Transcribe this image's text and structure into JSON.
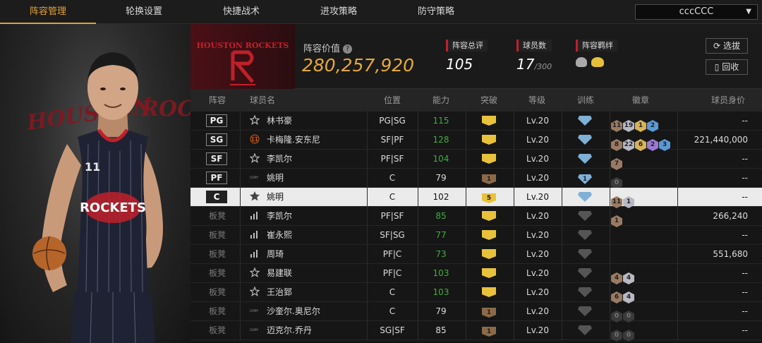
{
  "nav": {
    "tabs": [
      "阵容管理",
      "轮换设置",
      "快捷战术",
      "进攻策略",
      "防守策略"
    ],
    "active_tab": 0,
    "team_select": "cccCCC"
  },
  "header": {
    "logo_text": "HOUSTON ROCKETS",
    "value_label": "阵容价值",
    "value": "280,257,920",
    "overall_label": "阵容总评",
    "overall": "105",
    "players_label": "球员数",
    "players": "17",
    "players_max": "/300",
    "bond_label": "阵容羁绊",
    "btn_select": "选拔",
    "btn_recycle": "回收"
  },
  "player_panel": {
    "jersey_text": "ROCKETS",
    "jersey_number": "11",
    "bg_text": "HOUSTON ROCKETS"
  },
  "table": {
    "headers": {
      "lineup": "阵容",
      "name": "球员名",
      "position": "位置",
      "ability": "能力",
      "breakthrough": "突破",
      "level": "等级",
      "training": "训练",
      "badge": "徽章",
      "value": "球员身价"
    },
    "rows": [
      {
        "slot": "PG",
        "bench": false,
        "icon": "star",
        "name": "林书豪",
        "pos": "PG|SG",
        "ability": "115",
        "green": true,
        "brk": "gold",
        "brk_num": "",
        "level": "Lv.20",
        "train": "blue",
        "train_num": "",
        "badges": [
          [
            "bronze",
            "11"
          ],
          [
            "silver",
            "19"
          ],
          [
            "gold",
            "1"
          ],
          [
            "blue",
            "2"
          ]
        ],
        "value": "--"
      },
      {
        "slot": "SG",
        "bench": false,
        "icon": "jersey11",
        "name": "卡梅隆.安东尼",
        "pos": "SF|PF",
        "ability": "128",
        "green": true,
        "brk": "gold",
        "brk_num": "",
        "level": "Lv.20",
        "train": "blue",
        "train_num": "",
        "badges": [
          [
            "bronze",
            "8"
          ],
          [
            "silver",
            "22"
          ],
          [
            "gold",
            "6"
          ],
          [
            "purple",
            "2"
          ],
          [
            "blue",
            "3"
          ]
        ],
        "value": "221,440,000"
      },
      {
        "slot": "SF",
        "bench": false,
        "icon": "star",
        "name": "李凯尔",
        "pos": "PF|SF",
        "ability": "104",
        "green": true,
        "brk": "gold",
        "brk_num": "",
        "level": "Lv.20",
        "train": "blue",
        "train_num": "",
        "badges": [
          [
            "bronze",
            "7"
          ]
        ],
        "value": "--"
      },
      {
        "slot": "PF",
        "bench": false,
        "icon": "copy",
        "name": "姚明",
        "pos": "C",
        "ability": "79",
        "green": false,
        "brk": "brown",
        "brk_num": "1",
        "level": "Lv.20",
        "train": "blue",
        "train_num": "1",
        "badges": [
          [
            "dark",
            "0"
          ]
        ],
        "value": "--"
      },
      {
        "slot": "C",
        "bench": false,
        "icon": "starlg",
        "name": "姚明",
        "pos": "C",
        "ability": "102",
        "green": false,
        "brk": "gold",
        "brk_num": "5",
        "level": "Lv.20",
        "train": "blue",
        "train_num": "",
        "badges": [
          [
            "bronze",
            "11"
          ],
          [
            "silver",
            "1"
          ]
        ],
        "value": "--",
        "selected": true
      },
      {
        "slot": "板凳",
        "bench": true,
        "icon": "bars",
        "name": "李凯尔",
        "pos": "PF|SF",
        "ability": "85",
        "green": true,
        "brk": "gold",
        "brk_num": "",
        "level": "Lv.20",
        "train": "gray",
        "train_num": "",
        "badges": [
          [
            "bronze",
            "1"
          ]
        ],
        "value": "266,240"
      },
      {
        "slot": "板凳",
        "bench": true,
        "icon": "bars",
        "name": "崔永熙",
        "pos": "SF|SG",
        "ability": "77",
        "green": true,
        "brk": "gold",
        "brk_num": "",
        "level": "Lv.20",
        "train": "gray",
        "train_num": "",
        "badges": [],
        "value": "--"
      },
      {
        "slot": "板凳",
        "bench": true,
        "icon": "bars",
        "name": "周琦",
        "pos": "PF|C",
        "ability": "73",
        "green": true,
        "brk": "gold",
        "brk_num": "",
        "level": "Lv.20",
        "train": "gray",
        "train_num": "",
        "badges": [],
        "value": "551,680"
      },
      {
        "slot": "板凳",
        "bench": true,
        "icon": "star",
        "name": "易建联",
        "pos": "PF|C",
        "ability": "103",
        "green": true,
        "brk": "gold",
        "brk_num": "",
        "level": "Lv.20",
        "train": "gray",
        "train_num": "",
        "badges": [
          [
            "bronze",
            "4"
          ],
          [
            "silver",
            "4"
          ]
        ],
        "value": "--"
      },
      {
        "slot": "板凳",
        "bench": true,
        "icon": "star",
        "name": "王治郅",
        "pos": "C",
        "ability": "103",
        "green": true,
        "brk": "gold",
        "brk_num": "",
        "level": "Lv.20",
        "train": "gray",
        "train_num": "",
        "badges": [
          [
            "bronze",
            "6"
          ],
          [
            "silver",
            "4"
          ]
        ],
        "value": "--"
      },
      {
        "slot": "板凳",
        "bench": true,
        "icon": "copy",
        "name": "沙奎尔.奥尼尔",
        "pos": "C",
        "ability": "79",
        "green": false,
        "brk": "brown",
        "brk_num": "1",
        "level": "Lv.20",
        "train": "gray",
        "train_num": "",
        "badges": [
          [
            "dark",
            "0"
          ],
          [
            "dark",
            "0"
          ]
        ],
        "value": "--"
      },
      {
        "slot": "板凳",
        "bench": true,
        "icon": "copy",
        "name": "迈克尔.乔丹",
        "pos": "SG|SF",
        "ability": "85",
        "green": false,
        "brk": "brown",
        "brk_num": "1",
        "level": "Lv.20",
        "train": "gray",
        "train_num": "",
        "badges": [
          [
            "dark",
            "0"
          ],
          [
            "dark",
            "0"
          ]
        ],
        "value": "--"
      }
    ]
  },
  "colors": {
    "accent": "#e0a13a",
    "value": "#e5a93a",
    "green": "#3fae3f",
    "red": "#c0202a"
  },
  "icons": {
    "help": "help-circle-icon",
    "refresh": "refresh-icon",
    "recycle": "recycle-icon",
    "bond": "bond-icon",
    "caret": "chevron-down-icon"
  }
}
